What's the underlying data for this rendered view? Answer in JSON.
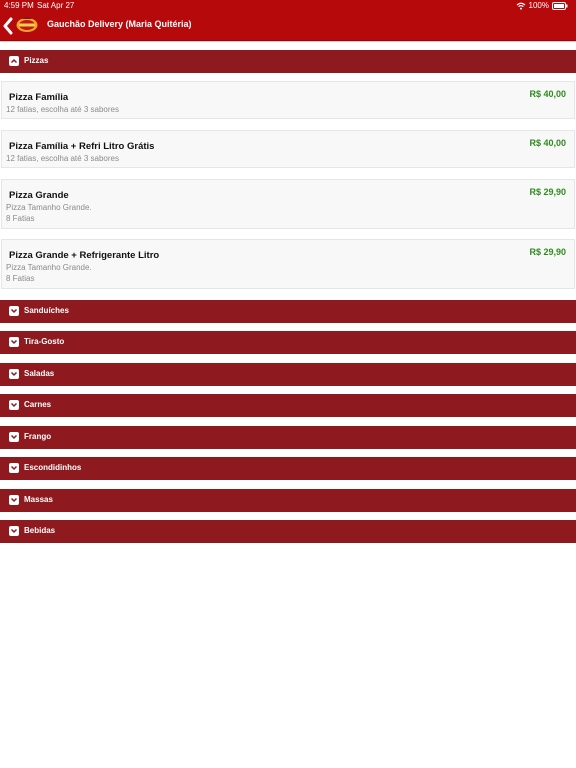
{
  "status": {
    "time": "4:59 PM",
    "date": "Sat Apr 27",
    "battery": "100%"
  },
  "nav": {
    "title": "Gauchão Delivery (Maria Quitéria)"
  },
  "categories": [
    {
      "label": "Pizzas",
      "expanded": true
    },
    {
      "label": "Sanduíches",
      "expanded": false
    },
    {
      "label": "Tira-Gosto",
      "expanded": false
    },
    {
      "label": "Saladas",
      "expanded": false
    },
    {
      "label": "Carnes",
      "expanded": false
    },
    {
      "label": "Frango",
      "expanded": false
    },
    {
      "label": "Escondidinhos",
      "expanded": false
    },
    {
      "label": "Massas",
      "expanded": false
    },
    {
      "label": "Bebidas",
      "expanded": false
    }
  ],
  "items": [
    {
      "name": "Pizza Família",
      "desc1": "12 fatias, escolha até 3 sabores",
      "desc2": "",
      "price": "R$ 40,00"
    },
    {
      "name": "Pizza Família + Refri Litro Grátis",
      "desc1": "12 fatias, escolha até 3 sabores",
      "desc2": "",
      "price": "R$ 40,00"
    },
    {
      "name": "Pizza Grande",
      "desc1": "Pizza Tamanho Grande.",
      "desc2": "8 Fatias",
      "price": "R$ 29,90"
    },
    {
      "name": "Pizza Grande + Refrigerante Litro",
      "desc1": "Pizza Tamanho Grande.",
      "desc2": "8 Fatias",
      "price": "R$ 29,90"
    }
  ],
  "colors": {
    "topbar": "#b5090c",
    "category": "#8e1a1f",
    "price": "#2f8a1d"
  }
}
